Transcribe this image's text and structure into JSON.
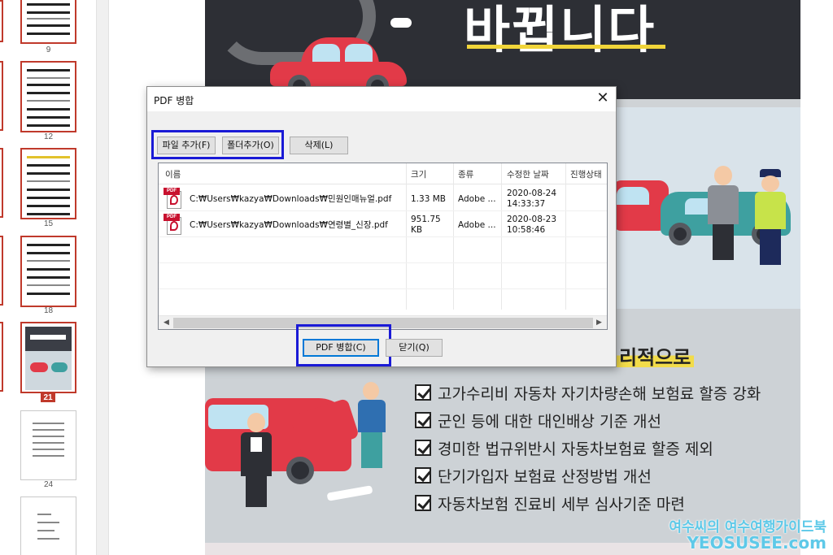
{
  "thumbnails": {
    "page_numbers": [
      "9",
      "12",
      "15",
      "18",
      "21",
      "24"
    ],
    "active_page": "21"
  },
  "document": {
    "banner_title": "바뀝니다",
    "headline": "리적으로",
    "checklist": [
      "고가수리비 자동차 자기차량손해 보험료 할증 강화",
      "군인 등에 대한 대인배상 기준 개선",
      "경미한 법규위반시 자동차보험료 할증 제외",
      "단기가입자 보험료 산정방법 개선",
      "자동차보험 진료비 세부 심사기준 마련"
    ]
  },
  "dialog": {
    "title": "PDF 병합",
    "close_glyph": "✕",
    "buttons": {
      "add_file": "파일 추가(F)",
      "add_folder": "폴더추가(O)",
      "delete": "삭제(L)",
      "merge": "PDF 병합(C)",
      "close": "닫기(Q)"
    },
    "columns": [
      "이름",
      "크기",
      "종류",
      "수정한 날짜",
      "진행상태"
    ],
    "files": [
      {
        "icon": "pdf-file-icon",
        "name": "C:₩Users₩kazya₩Downloads₩민원인매뉴얼.pdf",
        "size": "1.33 MB",
        "type": "Adobe ...",
        "date": "2020-08-24",
        "time": "14:33:37",
        "status": ""
      },
      {
        "icon": "pdf-file-icon",
        "name": "C:₩Users₩kazya₩Downloads₩연령별_신장.pdf",
        "size": "951.75",
        "size_unit": "KB",
        "type": "Adobe ...",
        "date": "2020-08-23",
        "time": "10:58:46",
        "status": ""
      }
    ],
    "highlight_color": "#1a1ad6"
  },
  "watermark": {
    "line1": "여수씨의 여수여행가이드북",
    "line2": "YEOSUSEE.com"
  },
  "colors": {
    "thumb_border": "#c0392b",
    "banner": "#2d2f35",
    "car_red": "#e23a48",
    "highlight_yellow": "#f2dc4a"
  }
}
